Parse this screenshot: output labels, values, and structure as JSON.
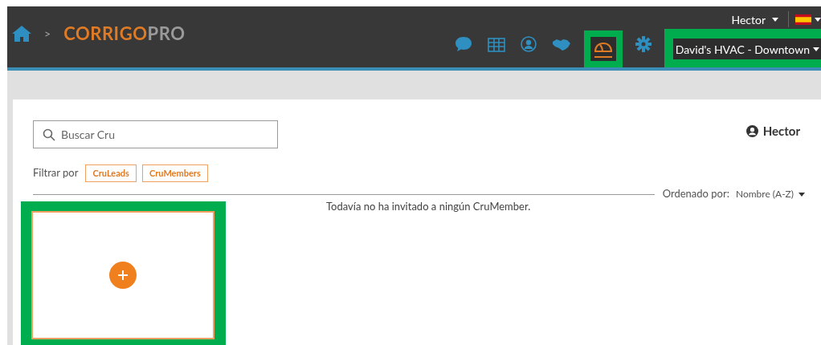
{
  "header": {
    "breadcrumb_separator": ">",
    "logo": {
      "primary": "CORRIGO",
      "secondary": "PRO"
    },
    "user_menu": "Hector",
    "language_menu": {
      "kind": "flag_spain"
    },
    "toolbar": [
      {
        "kind": "chat",
        "highlighted": false,
        "selected": false
      },
      {
        "kind": "table",
        "highlighted": false,
        "selected": false
      },
      {
        "kind": "user",
        "highlighted": false,
        "selected": false
      },
      {
        "kind": "handshake",
        "highlighted": false,
        "selected": false
      },
      {
        "kind": "hardhat",
        "highlighted": true,
        "selected": true
      },
      {
        "kind": "gear",
        "highlighted": false,
        "selected": false
      }
    ],
    "company_select": {
      "value": "David's HVAC - Downtown",
      "highlighted": true
    }
  },
  "search": {
    "placeholder": "Buscar Cru"
  },
  "current_user": "Hector",
  "filter": {
    "label": "Filtrar por",
    "chips": [
      "CruLeads",
      "CruMembers"
    ]
  },
  "sort": {
    "label": "Ordenado por:",
    "value": "Nombre (A-Z)"
  },
  "empty_message": "Todavía no ha invitado a ningún CruMember.",
  "add_card": {
    "highlighted": true
  }
}
